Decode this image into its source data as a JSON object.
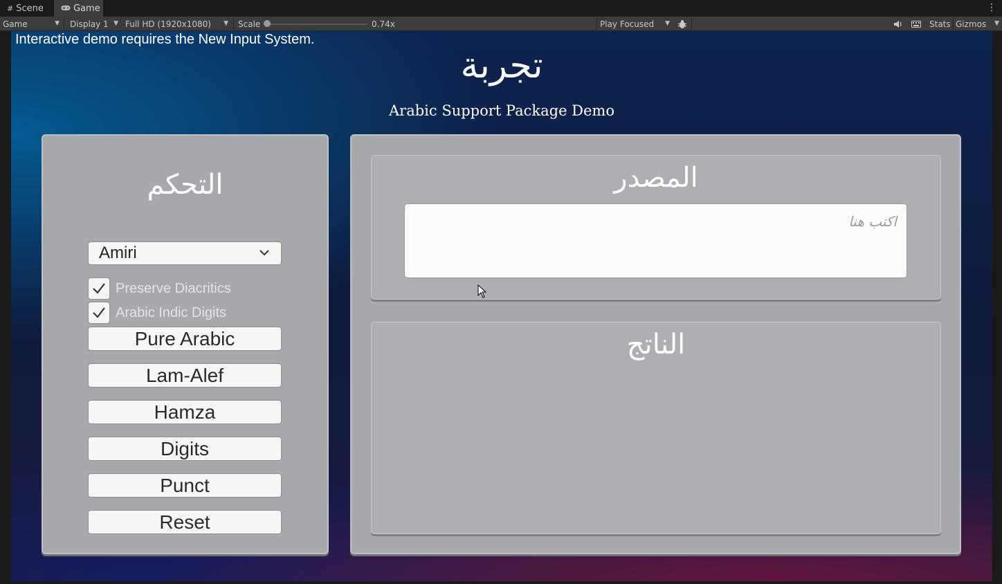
{
  "editor": {
    "tabs": [
      {
        "label": "Scene",
        "icon": "grid-icon"
      },
      {
        "label": "Game",
        "icon": "gamepad-icon"
      }
    ],
    "toolbar": {
      "view": "Game",
      "display": "Display 1",
      "resolution": "Full HD (1920x1080)",
      "scale_label": "Scale",
      "scale_value": "0.74x",
      "play_mode": "Play Focused",
      "stats": "Stats",
      "gizmos": "Gizmos"
    }
  },
  "game": {
    "notice": "Interactive demo requires the New Input System.",
    "title": "تجربة",
    "subtitle": "Arabic Support Package Demo",
    "controls": {
      "heading": "التحكم",
      "font_dropdown": "Amiri",
      "checkboxes": [
        {
          "label": "Preserve Diacritics",
          "checked": true
        },
        {
          "label": "Arabic Indic Digits",
          "checked": true
        }
      ],
      "buttons": [
        "Pure Arabic",
        "Lam-Alef",
        "Hamza",
        "Digits",
        "Punct",
        "Reset"
      ]
    },
    "source": {
      "heading": "المصدر",
      "placeholder": "اكتب هنا",
      "value": ""
    },
    "output": {
      "heading": "الناتج",
      "value": ""
    }
  }
}
